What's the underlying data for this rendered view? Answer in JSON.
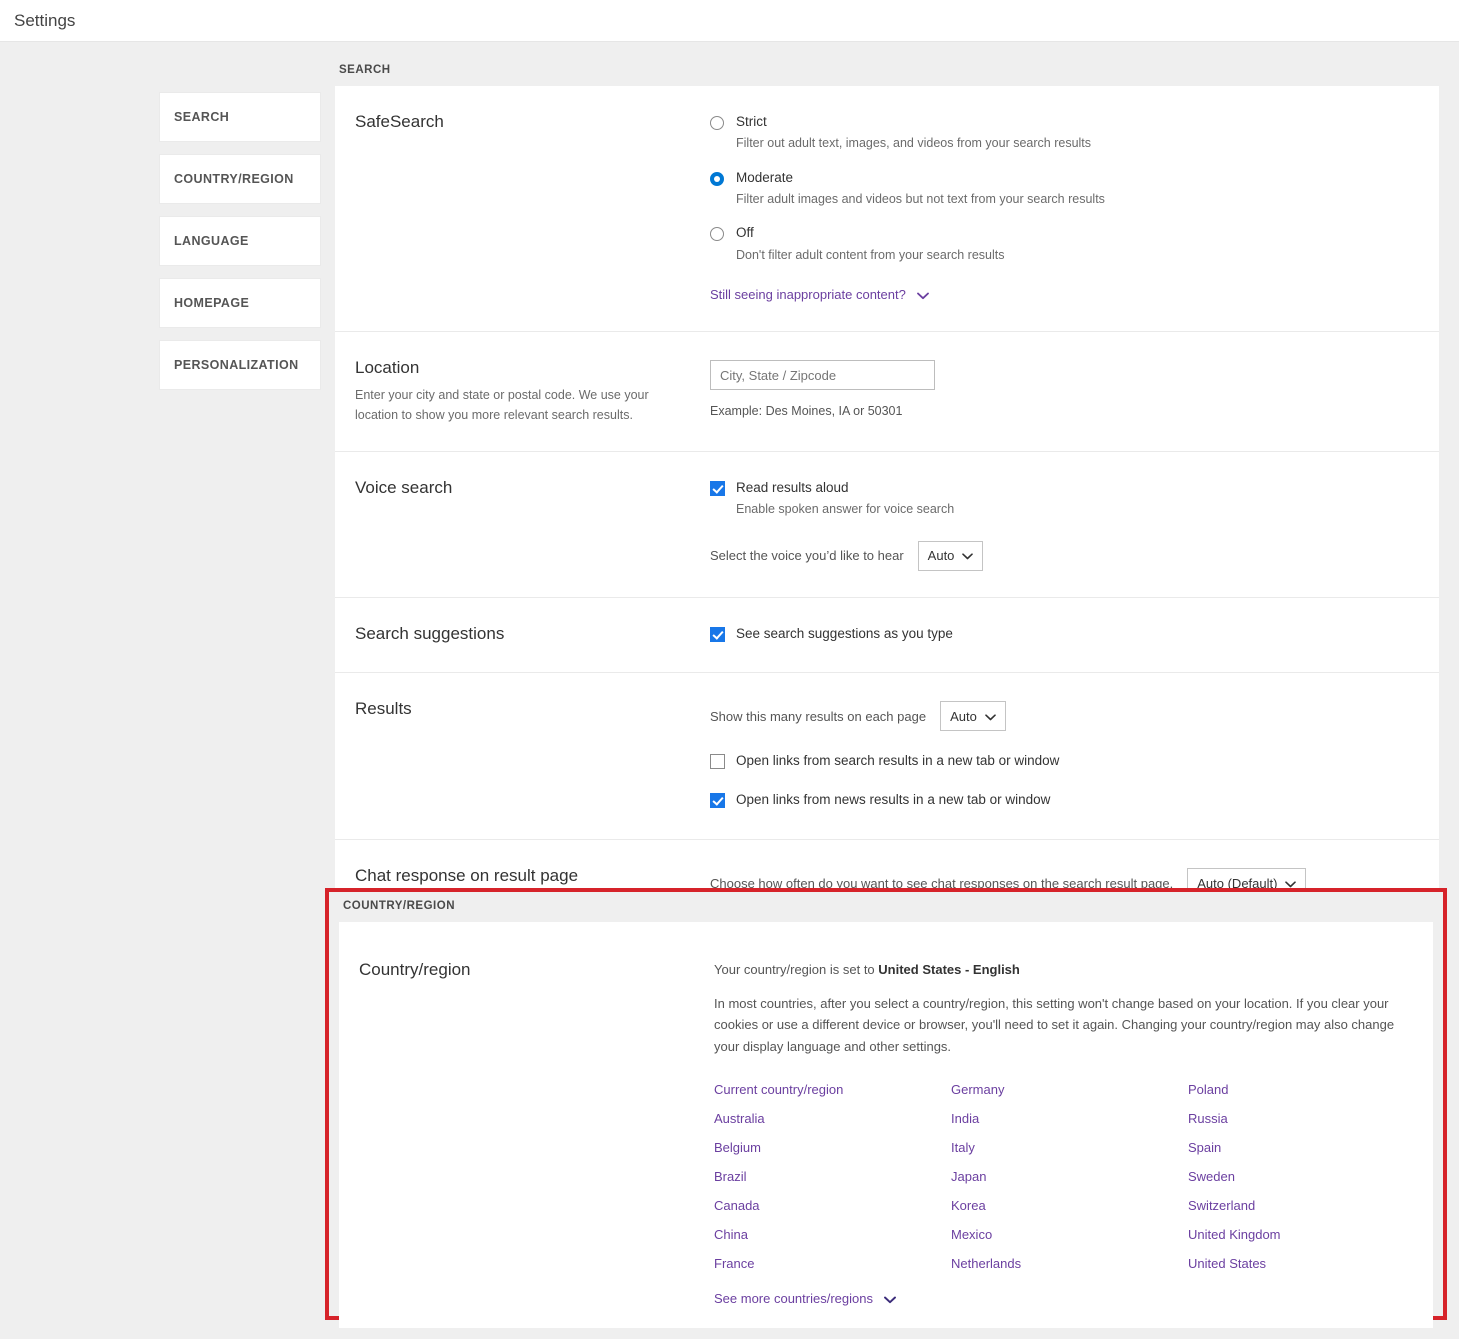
{
  "topbar": {
    "title": "Settings"
  },
  "sidenav": {
    "items": [
      {
        "label": "SEARCH"
      },
      {
        "label": "COUNTRY/REGION"
      },
      {
        "label": "LANGUAGE"
      },
      {
        "label": "HOMEPAGE"
      },
      {
        "label": "PERSONALIZATION"
      }
    ]
  },
  "search_section": {
    "label": "SEARCH",
    "safesearch": {
      "title": "SafeSearch",
      "options": [
        {
          "title": "Strict",
          "desc": "Filter out adult text, images, and videos from your search results",
          "checked": false
        },
        {
          "title": "Moderate",
          "desc": "Filter adult images and videos but not text from your search results",
          "checked": true
        },
        {
          "title": "Off",
          "desc": "Don't filter adult content from your search results",
          "checked": false
        }
      ],
      "expander_label": "Still seeing inappropriate content?",
      "expander_icon": "chevron-down-icon"
    },
    "location": {
      "title": "Location",
      "desc": "Enter your city and state or postal code. We use your location to show you more relevant search results.",
      "input_value": "",
      "input_placeholder": "City, State / Zipcode",
      "hint": "Example: Des Moines, IA or 50301"
    },
    "voice": {
      "title": "Voice search",
      "checkbox_label": "Read results aloud",
      "checkbox_desc": "Enable spoken answer for voice search",
      "checkbox_checked": true,
      "select_label": "Select the voice you’d like to hear",
      "select_value": "Auto"
    },
    "suggestions": {
      "title": "Search suggestions",
      "checkbox_label": "See search suggestions as you type",
      "checkbox_checked": true
    },
    "results": {
      "title": "Results",
      "select_label": "Show this many results on each page",
      "select_value": "Auto",
      "checkboxes": [
        {
          "label": "Open links from search results in a new tab or window",
          "checked": false
        },
        {
          "label": "Open links from news results in a new tab or window",
          "checked": true
        }
      ]
    },
    "chat": {
      "title": "Chat response on result page",
      "select_label": "Choose how often do you want to see chat responses on the search result page.",
      "select_value": "Auto (Default)"
    }
  },
  "country_section": {
    "label": "COUNTRY/REGION",
    "title": "Country/region",
    "set_to_prefix": "Your country/region is set to ",
    "set_to_value": "United States - English",
    "description": "In most countries, after you select a country/region, this setting won't change based on your location. If you clear your cookies or use a different device or browser, you'll need to set it again. Changing your country/region may also change your display language and other settings.",
    "countries_col1": [
      "Current country/region",
      "Australia",
      "Belgium",
      "Brazil",
      "Canada",
      "China",
      "France"
    ],
    "countries_col2": [
      "Germany",
      "India",
      "Italy",
      "Japan",
      "Korea",
      "Mexico",
      "Netherlands"
    ],
    "countries_col3": [
      "Poland",
      "Russia",
      "Spain",
      "Sweden",
      "Switzerland",
      "United Kingdom",
      "United States"
    ],
    "see_more_label": "See more countries/regions",
    "see_more_icon": "chevron-down-icon",
    "highlight_color": "#d6232a"
  },
  "colors": {
    "page_background": "#efefef",
    "panel": "#ffffff",
    "link": "#6b3fa0",
    "accent_checked": "#1877e8",
    "radio_checked": "#0078d4"
  }
}
